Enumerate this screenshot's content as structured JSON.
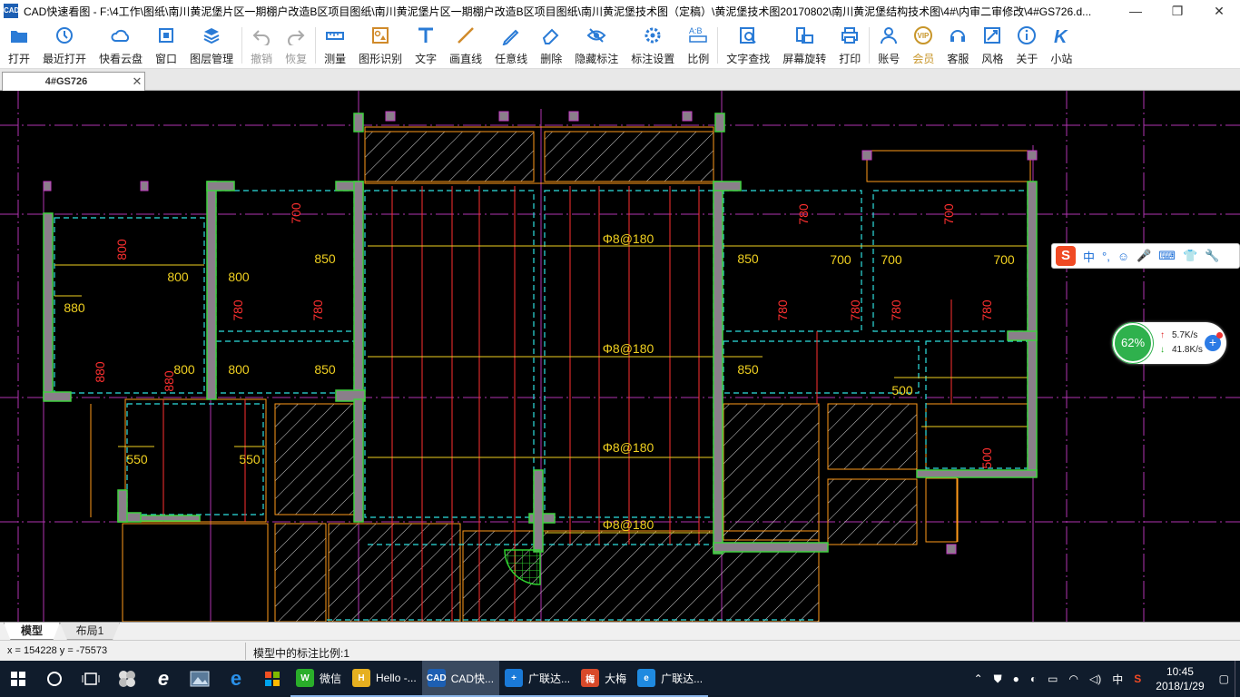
{
  "titlebar": {
    "app_icon": "CAD",
    "title": "CAD快速看图 - F:\\4工作\\图纸\\南川黄泥堡片区一期棚户改造B区项目图纸\\南川黄泥堡片区一期棚户改造B区项目图纸\\南川黄泥堡技术图（定稿）\\黄泥堡技术图20170802\\南川黄泥堡结构技术图\\4#\\内审二审修改\\4#GS726.d...",
    "minimize": "—",
    "maximize": "❐",
    "close": "✕"
  },
  "toolbar": {
    "items": [
      {
        "label": "打开",
        "icon": "folder-open-icon",
        "color": "#2a7bd6"
      },
      {
        "label": "最近打开",
        "icon": "recent-clock-icon",
        "color": "#2a7bd6"
      },
      {
        "label": "快看云盘",
        "icon": "cloud-icon",
        "color": "#2a7bd6"
      },
      {
        "label": "窗口",
        "icon": "window-icon",
        "color": "#2a7bd6"
      },
      {
        "label": "图层管理",
        "icon": "layers-icon",
        "color": "#2a7bd6"
      },
      {
        "label": "撤销",
        "icon": "undo-icon",
        "color": "#aaaaaa",
        "disabled": true
      },
      {
        "label": "恢复",
        "icon": "redo-icon",
        "color": "#aaaaaa",
        "disabled": true
      },
      {
        "label": "测量",
        "icon": "measure-icon",
        "color": "#2a7bd6"
      },
      {
        "label": "图形识别",
        "icon": "shape-recognize-icon",
        "color": "#d08a2a"
      },
      {
        "label": "文字",
        "icon": "text-icon",
        "color": "#2a7bd6"
      },
      {
        "label": "画直线",
        "icon": "line-icon",
        "color": "#d08a2a"
      },
      {
        "label": "任意线",
        "icon": "pen-icon",
        "color": "#2a7bd6"
      },
      {
        "label": "删除",
        "icon": "eraser-icon",
        "color": "#2a7bd6"
      },
      {
        "label": "隐藏标注",
        "icon": "hide-eye-icon",
        "color": "#2a7bd6"
      },
      {
        "label": "标注设置",
        "icon": "annotation-settings-icon",
        "color": "#2a7bd6"
      },
      {
        "label": "比例",
        "icon": "scale-icon",
        "color": "#2a7bd6"
      },
      {
        "label": "文字查找",
        "icon": "text-search-icon",
        "color": "#2a7bd6"
      },
      {
        "label": "屏幕旋转",
        "icon": "rotate-screen-icon",
        "color": "#2a7bd6"
      },
      {
        "label": "打印",
        "icon": "printer-icon",
        "color": "#2a7bd6"
      },
      {
        "label": "账号",
        "icon": "account-icon",
        "color": "#2a7bd6"
      },
      {
        "label": "会员",
        "icon": "vip-icon",
        "color": "#c8962a",
        "vip": true
      },
      {
        "label": "客服",
        "icon": "headset-icon",
        "color": "#2a7bd6"
      },
      {
        "label": "风格",
        "icon": "style-icon",
        "color": "#2a7bd6"
      },
      {
        "label": "关于",
        "icon": "info-icon",
        "color": "#2a7bd6"
      },
      {
        "label": "小站",
        "icon": "site-k-icon",
        "color": "#2a7bd6"
      }
    ]
  },
  "doc_tab": {
    "name": "4#GS726",
    "close": "✕"
  },
  "drawing": {
    "rebar_labels": [
      "Φ8@180",
      "Φ8@180",
      "Φ8@180",
      "Φ8@180"
    ],
    "dims": [
      "800",
      "800",
      "800",
      "880",
      "700",
      "850",
      "780",
      "780",
      "800",
      "800",
      "850",
      "880",
      "880",
      "550",
      "550",
      "780",
      "850",
      "700",
      "700",
      "700",
      "780",
      "780",
      "780",
      "780",
      "850",
      "700",
      "500",
      "500"
    ],
    "colors": {
      "wall": "#8a7f8a",
      "wall_edge": "#3fd13f",
      "cyan": "#2ee0e0",
      "red": "#ff3030",
      "yellow": "#f0d020",
      "orange": "#ff9a1a",
      "magenta": "#d040d0",
      "hatch": "#e0e0e0"
    }
  },
  "ime": {
    "logo": "S",
    "items": [
      "中",
      "°,",
      "☺",
      "🎤",
      "⌨",
      "👕",
      "👔",
      "🔧"
    ]
  },
  "netmon": {
    "percent": "62%",
    "up": "5.7K/s",
    "down": "41.8K/s",
    "plus": "+"
  },
  "layout_tabs": [
    "模型",
    "布局1"
  ],
  "status": {
    "coord": "x = 154228  y = -75573",
    "scale": "模型中的标注比例:1"
  },
  "taskbar": {
    "apps": [
      {
        "label": "微信",
        "icon": "wechat-icon",
        "bg": "#2aae2a",
        "glyph": "W"
      },
      {
        "label": "Hello -...",
        "icon": "hello-app-icon",
        "bg": "#e6b020",
        "glyph": "H"
      },
      {
        "label": "CAD快...",
        "icon": "cad-app-icon",
        "bg": "#1d5fb3",
        "glyph": "CAD",
        "active": true
      },
      {
        "label": "广联达...",
        "icon": "glodon-icon",
        "bg": "#1a7ad8",
        "glyph": "+"
      },
      {
        "label": "大梅",
        "icon": "dameimei-icon",
        "bg": "#d84a2a",
        "glyph": "梅"
      },
      {
        "label": "广联达...",
        "icon": "ie-icon",
        "bg": "#1f8ae0",
        "glyph": "e"
      }
    ],
    "tray_ime": "中",
    "time": "10:45",
    "date": "2018/1/29"
  }
}
